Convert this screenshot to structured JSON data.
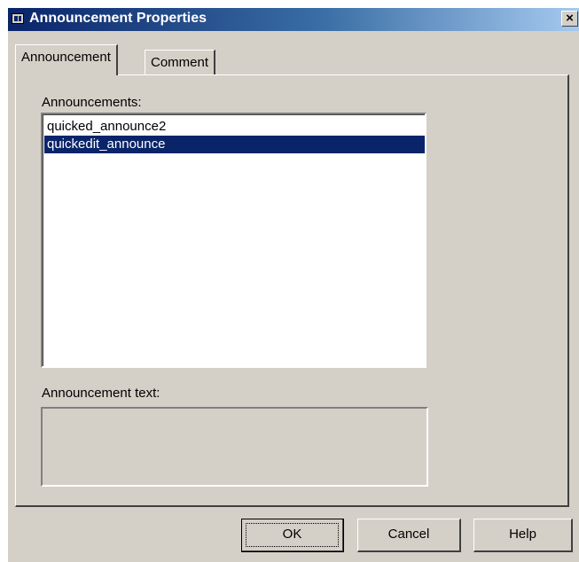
{
  "window": {
    "title": "Announcement Properties",
    "close_label": "×"
  },
  "tabs": [
    {
      "label": "Announcement",
      "active": true
    },
    {
      "label": "Comment",
      "active": false
    }
  ],
  "announcements": {
    "label": "Announcements:",
    "items": [
      {
        "text": "quicked_announce2",
        "selected": false
      },
      {
        "text": "quickedit_announce",
        "selected": true
      }
    ]
  },
  "announcement_text": {
    "label": "Announcement text:",
    "value": ""
  },
  "buttons": {
    "ok": "OK",
    "cancel": "Cancel",
    "help": "Help"
  },
  "colors": {
    "face": "#d4d0c8",
    "selection": "#0a246a",
    "title_start": "#0a246a"
  }
}
